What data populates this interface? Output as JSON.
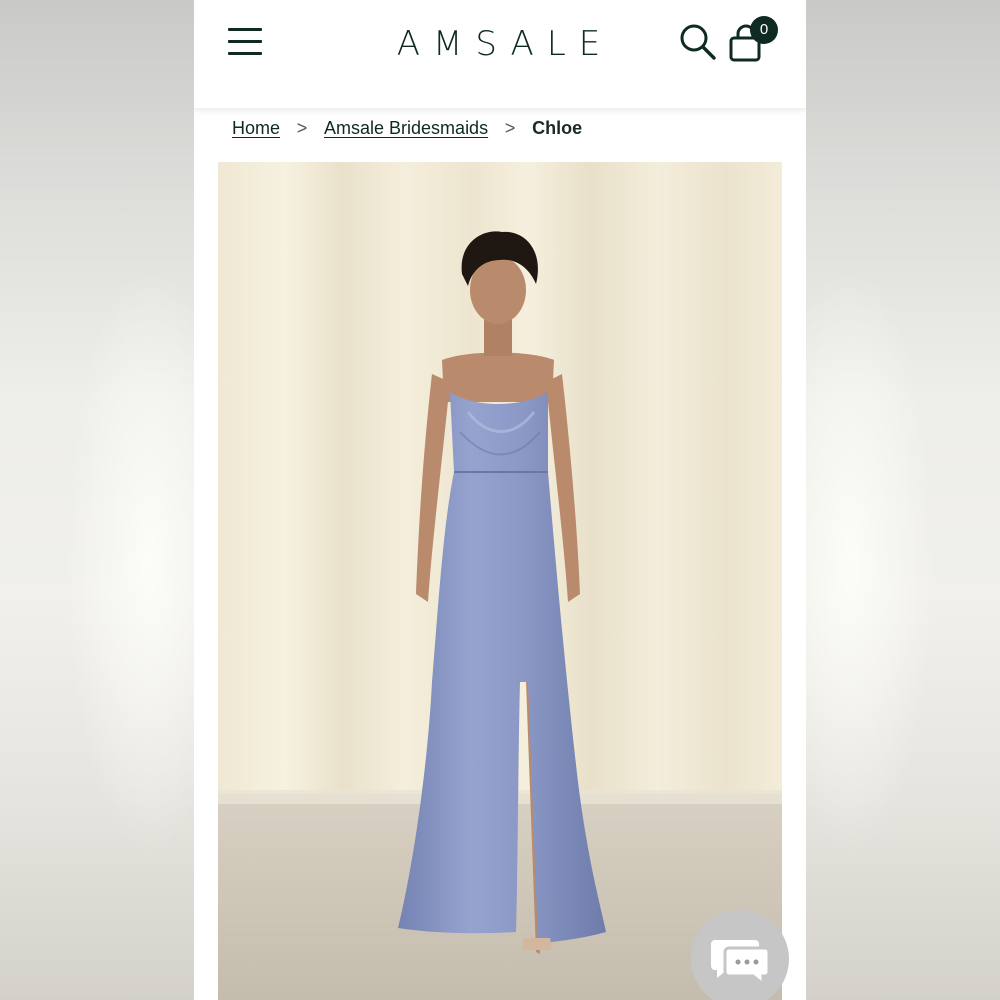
{
  "header": {
    "logo_text": "AMSALE",
    "menu_icon": "hamburger-menu-icon",
    "search_icon": "search-icon",
    "cart_icon": "shopping-bag-icon",
    "cart_count": "0",
    "brand_color": "#0e2a22"
  },
  "breadcrumb": {
    "items": [
      {
        "label": "Home"
      },
      {
        "label": "Amsale Bridesmaids "
      }
    ],
    "separator": ">",
    "current": "Chloe"
  },
  "product": {
    "image_icon": "product-photo",
    "dress_color": "#8896c2"
  },
  "chat": {
    "icon": "chat-bubble-icon"
  }
}
